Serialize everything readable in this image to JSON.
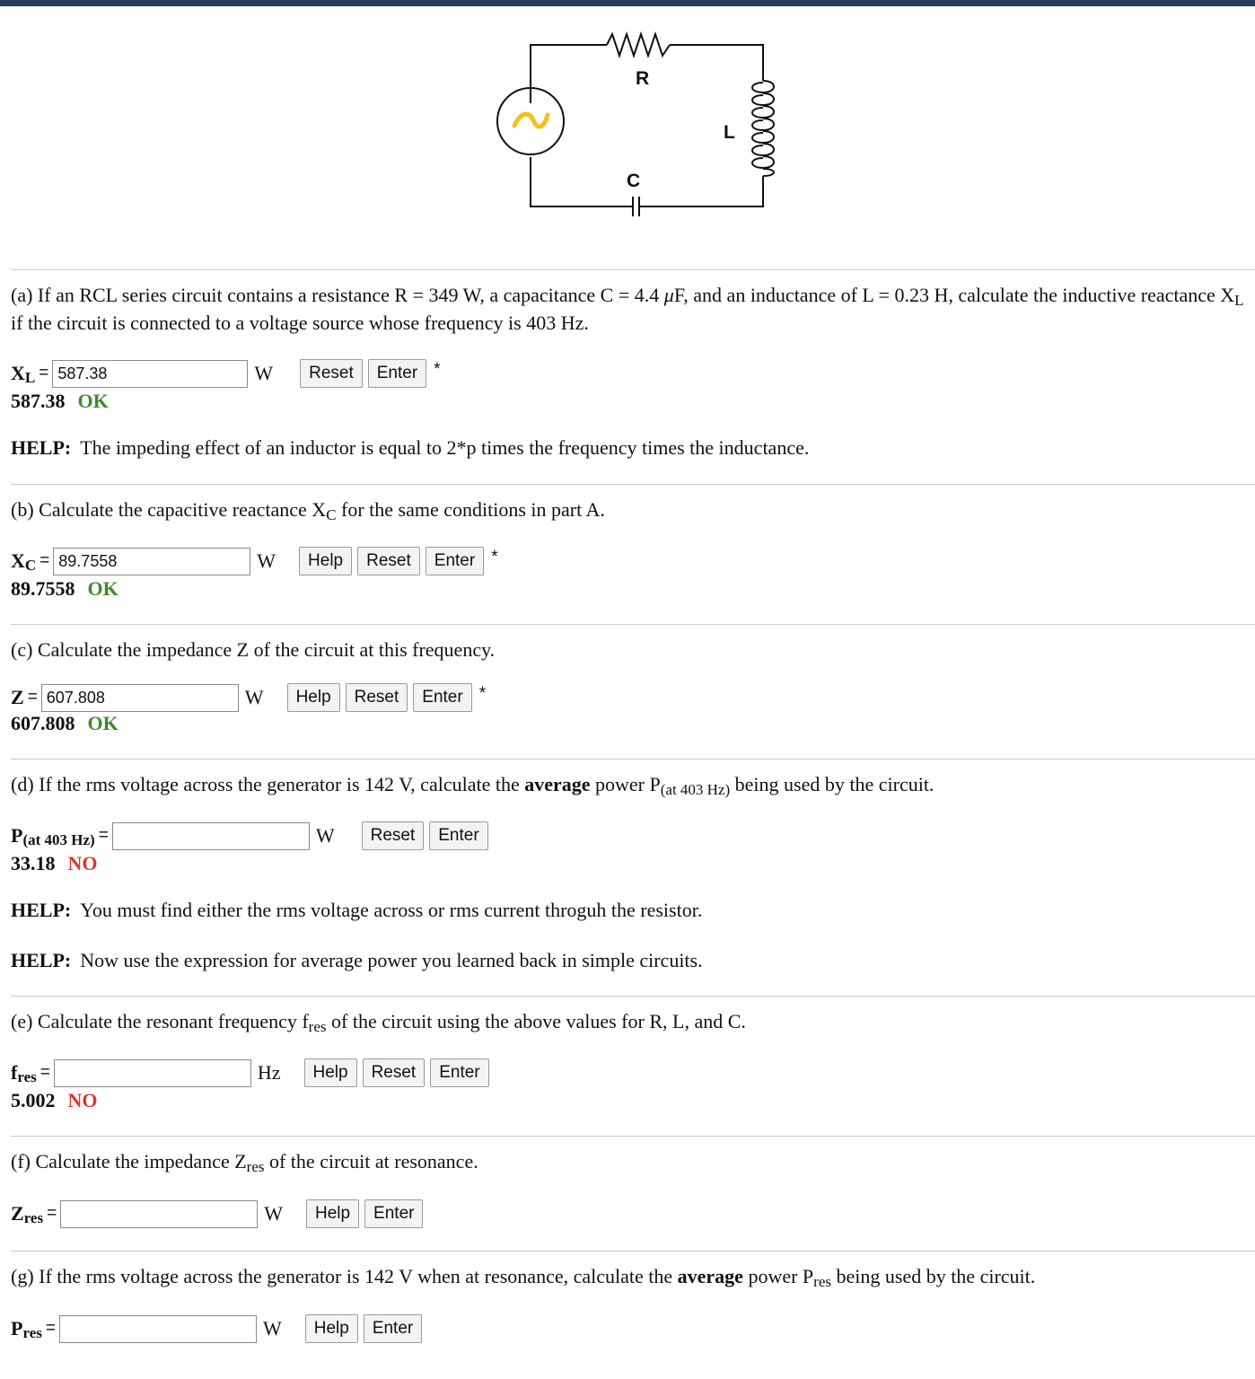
{
  "diagram": {
    "r_label": "R",
    "l_label": "L",
    "c_label": "C",
    "source_symbol": "~"
  },
  "parts": {
    "a": {
      "question_pre": "(a) If an RCL series circuit contains a resistance R = 349 W, a capacitance C = 4.4 ",
      "mu": "μ",
      "question_mid": "F, and an inductance of L = 0.23 H, calculate the inductive reactance X",
      "sub": "L",
      "question_post": " if the circuit is connected to a voltage source whose frequency is 403 Hz.",
      "var": "X",
      "var_sub": "L",
      "eq": "=",
      "value": "587.38",
      "unit": "W",
      "reset": "Reset",
      "enter": "Enter",
      "star": "*",
      "result_value": "587.38",
      "result_status": "OK",
      "help_label": "HELP:",
      "help_text": "The impeding effect of an inductor is equal to 2*p times the frequency times the inductance."
    },
    "b": {
      "question_pre": "(b) Calculate the capacitive reactance X",
      "sub": "C",
      "question_post": " for the same conditions in part A.",
      "var": "X",
      "var_sub": "C",
      "eq": "=",
      "value": "89.7558",
      "unit": "W",
      "help": "Help",
      "reset": "Reset",
      "enter": "Enter",
      "star": "*",
      "result_value": "89.7558",
      "result_status": "OK"
    },
    "c": {
      "question": "(c) Calculate the impedance Z of the circuit at this frequency.",
      "var": "Z",
      "eq": "=",
      "value": "607.808",
      "unit": "W",
      "help": "Help",
      "reset": "Reset",
      "enter": "Enter",
      "star": "*",
      "result_value": "607.808",
      "result_status": "OK"
    },
    "d": {
      "question_pre": "(d) If the rms voltage across the generator is 142 V, calculate the ",
      "bold": "average",
      "question_mid": " power P",
      "sub": "(at 403 Hz)",
      "question_post": " being used by the circuit.",
      "var": "P",
      "var_sub": "(at 403 Hz)",
      "eq": "=",
      "value": "",
      "unit": "W",
      "reset": "Reset",
      "enter": "Enter",
      "result_value": "33.18",
      "result_status": "NO",
      "help1_label": "HELP:",
      "help1_text": "You must find either the rms voltage across or rms current throguh the resistor.",
      "help2_label": "HELP:",
      "help2_text": "Now use the expression for average power you learned back in simple circuits."
    },
    "e": {
      "question_pre": "(e) Calculate the resonant frequency f",
      "sub": "res",
      "question_post": " of the circuit using the above values for R, L, and C.",
      "var": "f",
      "var_sub": "res",
      "eq": "=",
      "value": "",
      "unit": "Hz",
      "help": "Help",
      "reset": "Reset",
      "enter": "Enter",
      "result_value": "5.002",
      "result_status": "NO"
    },
    "f": {
      "question_pre": "(f) Calculate the impedance Z",
      "sub": "res",
      "question_post": " of the circuit at resonance.",
      "var": "Z",
      "var_sub": "res",
      "eq": "=",
      "value": "",
      "unit": "W",
      "help": "Help",
      "enter": "Enter"
    },
    "g": {
      "question_pre": "(g) If the rms voltage across the generator is 142 V when at resonance, calculate the ",
      "bold": "average",
      "question_mid": " power P",
      "sub": "res",
      "question_post": " being used by the circuit.",
      "var": "P",
      "var_sub": "res",
      "eq": "=",
      "value": "",
      "unit": "W",
      "help": "Help",
      "enter": "Enter"
    }
  },
  "colors": {
    "top_bar": "#2c3e5a",
    "ok": "#3e8a28",
    "no": "#e0342a",
    "source_wave": "#f0c419"
  }
}
